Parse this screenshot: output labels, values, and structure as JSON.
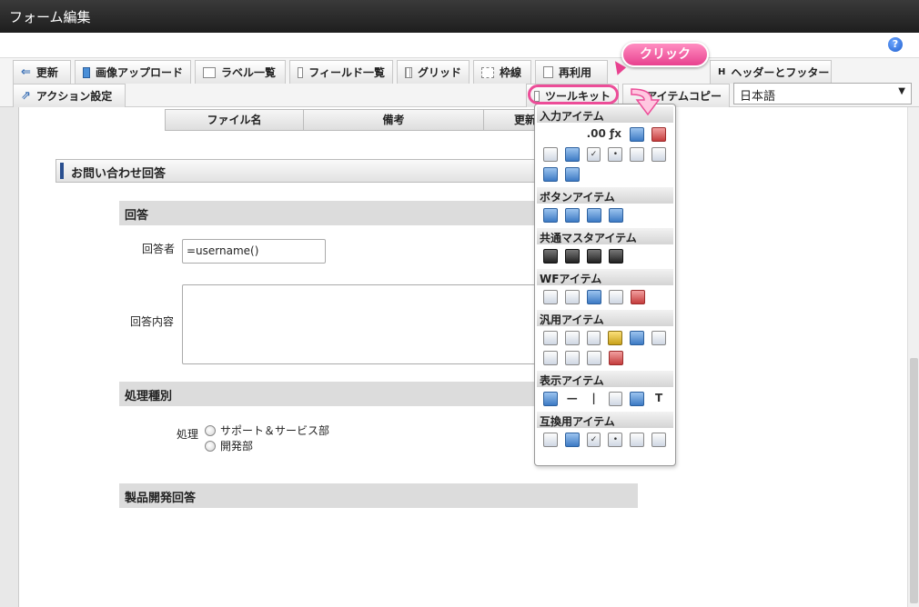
{
  "window": {
    "title": "フォーム編集"
  },
  "help": {
    "glyph": "?"
  },
  "toolbar": {
    "row1": [
      {
        "label": "更新",
        "icon": "update-icon",
        "key": "update"
      },
      {
        "label": "画像アップロード",
        "icon": "image-upload-icon",
        "key": "image-upload"
      },
      {
        "label": "ラベル一覧",
        "icon": "label-list-icon",
        "key": "label-list"
      },
      {
        "label": "フィールド一覧",
        "icon": "field-list-icon",
        "key": "field-list"
      },
      {
        "label": "グリッド",
        "icon": "grid-icon",
        "key": "grid"
      },
      {
        "label": "枠線",
        "icon": "border-icon",
        "key": "border"
      },
      {
        "label": "再利用",
        "icon": "reuse-icon",
        "key": "reuse"
      },
      {
        "label": "ヘッダーとフッター",
        "icon": "header-footer-icon",
        "key": "header-footer"
      }
    ],
    "row2": {
      "action_label": "アクション設定",
      "toolkit_label": "ツールキット",
      "item_copy_label": "アイテムコピー",
      "language": "日本語"
    }
  },
  "callout": {
    "text": "クリック"
  },
  "grid_table": {
    "columns": [
      "ファイル名",
      "備考",
      "更新"
    ]
  },
  "form": {
    "section_title": "お問い合わせ回答",
    "answer_section": "回答",
    "respondent_label": "回答者",
    "respondent_value": "=username()",
    "content_label": "回答内容",
    "process_section": "処理種別",
    "process_label": "処理",
    "process_options": [
      "サポート＆サービス部",
      "開発部"
    ],
    "product_section": "製品開発回答"
  },
  "toolkit": {
    "categories": [
      {
        "label": "入力アイテム",
        "rows": [
          [
            "textbox",
            "textbox-2",
            ".00",
            "fx",
            "date-blue",
            "date-red"
          ],
          [
            "select",
            "table",
            "check",
            "radio",
            "list",
            "list-2"
          ],
          [
            "upload",
            "table-2"
          ]
        ]
      },
      {
        "label": "ボタンアイテム",
        "rows": [
          [
            "button-ok",
            "next",
            "back",
            "back-2"
          ]
        ]
      },
      {
        "label": "共通マスタアイテム",
        "rows": [
          [
            "user",
            "building",
            "org",
            "org-2"
          ]
        ]
      },
      {
        "label": "WFアイテム",
        "rows": [
          [
            "clipboard",
            "attach",
            "image",
            "report",
            "stamp"
          ]
        ]
      },
      {
        "label": "汎用アイテム",
        "rows": [
          [
            "dotted",
            "doc",
            "camera",
            "folder",
            "upload-doc",
            "download-doc"
          ],
          [
            "panel",
            "card",
            "tree",
            "calendar"
          ]
        ]
      },
      {
        "label": "表示アイテム",
        "rows": [
          [
            "label",
            "hline",
            "vline",
            "box",
            "image-2",
            "text"
          ]
        ]
      },
      {
        "label": "互換用アイテム",
        "rows": [
          [
            "select-2",
            "table-3",
            "check-2",
            "radio-2",
            "list-3",
            "list-4"
          ]
        ]
      }
    ]
  },
  "colors": {
    "accent_pink": "#ec4d98",
    "section_bar": "#2a4f8f"
  }
}
